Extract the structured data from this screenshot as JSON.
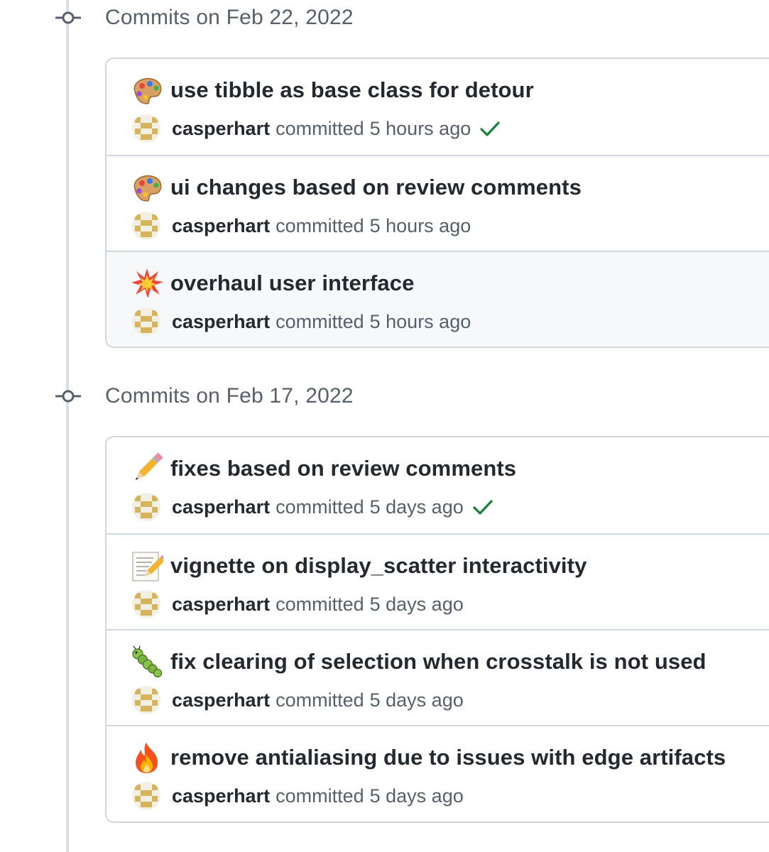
{
  "groups": [
    {
      "title": "Commits on Feb 22, 2022",
      "commits": [
        {
          "emoji": "palette-emoji",
          "title": "use tibble as base class for detour",
          "author": "casperhart",
          "verb": "committed",
          "time": "5 hours ago",
          "status": "success"
        },
        {
          "emoji": "palette-emoji",
          "title": "ui changes based on review comments",
          "author": "casperhart",
          "verb": "committed",
          "time": "5 hours ago",
          "status": ""
        },
        {
          "emoji": "collision-emoji",
          "title": "overhaul user interface",
          "author": "casperhart",
          "verb": "committed",
          "time": "5 hours ago",
          "status": "",
          "hovered": true
        }
      ]
    },
    {
      "title": "Commits on Feb 17, 2022",
      "commits": [
        {
          "emoji": "pencil-emoji",
          "title": "fixes based on review comments",
          "author": "casperhart",
          "verb": "committed",
          "time": "5 days ago",
          "status": "success"
        },
        {
          "emoji": "memo-emoji",
          "title": "vignette on display_scatter interactivity",
          "author": "casperhart",
          "verb": "committed",
          "time": "5 days ago",
          "status": ""
        },
        {
          "emoji": "caterpillar-emoji",
          "title": "fix clearing of selection when crosstalk is not used",
          "author": "casperhart",
          "verb": "committed",
          "time": "5 days ago",
          "status": ""
        },
        {
          "emoji": "fire-emoji",
          "title": "remove antialiasing due to issues with edge artifacts",
          "author": "casperhart",
          "verb": "committed",
          "time": "5 days ago",
          "status": ""
        }
      ]
    }
  ],
  "colors": {
    "success": "#1a7f37",
    "muted": "#57606a",
    "border": "#d0d7de",
    "timeline": "#d8dee4",
    "hover_bg": "#f6f8fa"
  }
}
